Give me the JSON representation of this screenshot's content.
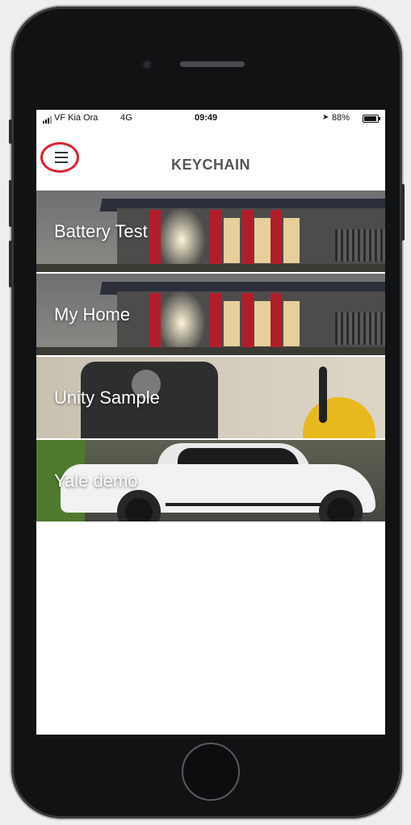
{
  "status_bar": {
    "carrier": "VF Kia Ora",
    "network": "4G",
    "time": "09:49",
    "battery": "88%"
  },
  "nav": {
    "title": "KEYCHAIN",
    "menu_icon": "hamburger-menu-icon",
    "highlight_color": "#e0202a"
  },
  "keys": [
    {
      "label": "Battery Test",
      "image": "house-photo"
    },
    {
      "label": "My Home",
      "image": "house-photo"
    },
    {
      "label": "Unity Sample",
      "image": "yale-lock-photo"
    },
    {
      "label": "Yale demo",
      "image": "white-car-photo"
    }
  ]
}
